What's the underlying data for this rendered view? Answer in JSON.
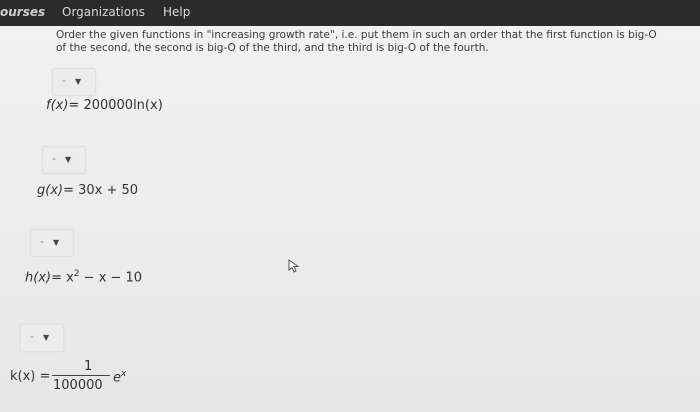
{
  "nav": {
    "courses": "ourses",
    "organizations": "Organizations",
    "help": "Help"
  },
  "instructions": {
    "line1": "Order the given functions in \"increasing growth rate\", i.e. put them in such an order that the first function is big-O",
    "line2": "of the second, the second is big-O of the third, and the third is big-O of the fourth."
  },
  "dropdowns": [
    {
      "value": "-"
    },
    {
      "value": "-"
    },
    {
      "value": "-"
    },
    {
      "value": "-"
    }
  ],
  "functions": {
    "f": {
      "lhs": "f(x)",
      "rhs": "= 200000ln(x)"
    },
    "g": {
      "lhs": "g(x)",
      "rhs": "= 30x + 50"
    },
    "h": {
      "lhs": "h(x)",
      "rhs_a": "= x",
      "exp": "2",
      "rhs_b": " − x − 10"
    },
    "k": {
      "lhs": "k(x) =",
      "numerator": "1",
      "denominator": "100000",
      "base": "e",
      "exp": "x"
    }
  }
}
